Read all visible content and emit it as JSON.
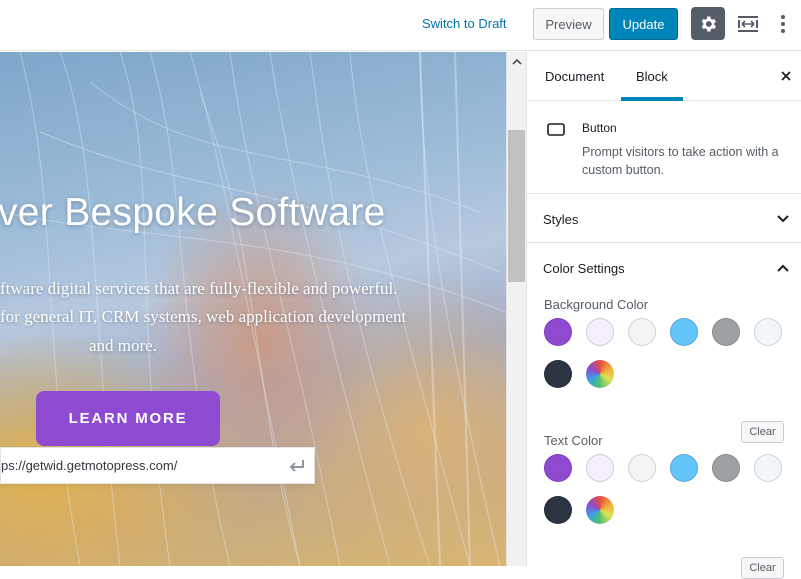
{
  "toolbar": {
    "switch_to_draft": "Switch to Draft",
    "preview": "Preview",
    "update": "Update",
    "icons": [
      "gear-icon",
      "resize-icon",
      "more-vertical-icon"
    ],
    "update_color": "#0085ba"
  },
  "canvas": {
    "hero_title": "ver Bespoke Software",
    "hero_lines": [
      "ftware digital services that are fully-flexible and powerful.",
      " for general IT, CRM systems, web application  development",
      "and more."
    ],
    "button_label": "LEARN MORE",
    "button_color": "#8e4ad1",
    "url_value": "ps://getwid.getmotopress.com/",
    "url_submit_icon": "enter-arrow-icon"
  },
  "sidebar": {
    "tabs": [
      {
        "label": "Document"
      },
      {
        "label": "Block",
        "active": true
      }
    ],
    "block": {
      "icon": "button-block-icon",
      "name": "Button",
      "description": "Prompt visitors to take action with a custom button."
    },
    "panels": {
      "styles_title": "Styles",
      "color_settings_title": "Color Settings",
      "background_label": "Background Color",
      "text_label": "Text Color",
      "clear_label": "Clear"
    },
    "palette": [
      "#8e4ad1",
      "#f5eefc",
      "#f2f4f5",
      "#62c4f9",
      "#9ea1a3",
      "#f2f6f8",
      "#2b3440",
      "gradient"
    ]
  }
}
